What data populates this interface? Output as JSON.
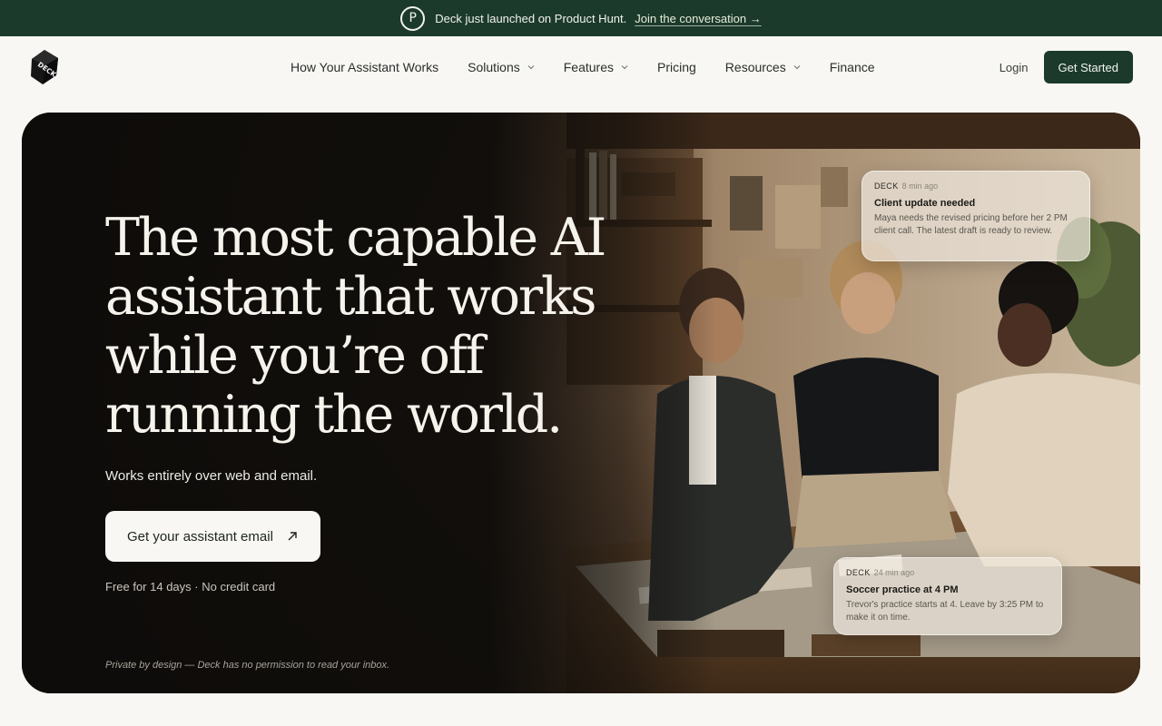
{
  "announcement": {
    "badge": "P",
    "text": "Deck just launched on Product Hunt.",
    "link": "Join the conversation →"
  },
  "brand": {
    "logo_text": "DECK"
  },
  "nav": {
    "items": [
      {
        "label": "How Your Assistant Works",
        "has_dropdown": false
      },
      {
        "label": "Solutions",
        "has_dropdown": true
      },
      {
        "label": "Features",
        "has_dropdown": true
      },
      {
        "label": "Pricing",
        "has_dropdown": false
      },
      {
        "label": "Resources",
        "has_dropdown": true
      },
      {
        "label": "Finance",
        "has_dropdown": false
      }
    ],
    "login": "Login",
    "cta": "Get Started"
  },
  "hero": {
    "headline_lines": [
      "The most capable AI",
      "assistant that works",
      "while you’re off",
      "running the world."
    ],
    "subline": "Works entirely over web and email.",
    "cta": "Get your assistant email",
    "fineprint": "Free for 14 days · No credit card",
    "privacy": "Private by design — Deck has no permission to read your inbox."
  },
  "notifications": [
    {
      "sender": "DECK",
      "time": "8 min ago",
      "title": "Client update needed",
      "body": "Maya needs the revised pricing before her 2 PM client call. The latest draft is ready to review."
    },
    {
      "sender": "DECK",
      "time": "24 min ago",
      "title": "Soccer practice at 4 PM",
      "body": "Trevor's practice starts at 4. Leave by 3:25 PM to make it on time."
    }
  ],
  "colors": {
    "brand_green": "#1b3a2b",
    "page_bg": "#f8f7f3",
    "hero_bg": "#0f0d0b"
  }
}
